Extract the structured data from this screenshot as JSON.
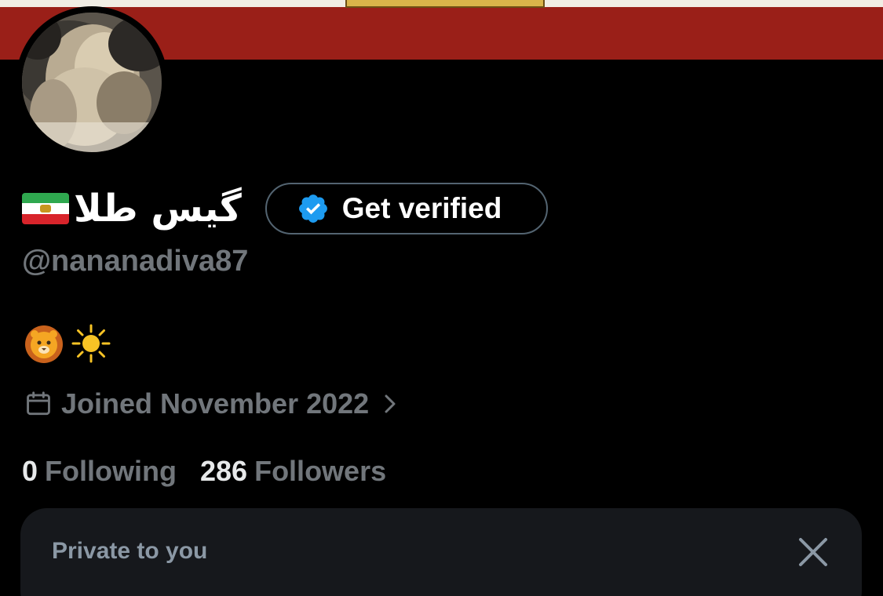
{
  "profile": {
    "display_name": "گیس طلا",
    "flag_icon": "iran-lion-and-sun-flag",
    "handle": "@nananadiva87",
    "bio_emojis": [
      "lion-face-emoji",
      "sun-emoji"
    ],
    "joined_text": "Joined November 2022"
  },
  "verify_button": {
    "label": "Get verified",
    "icon": "verified-badge-icon",
    "badge_color": "#1d9bf0"
  },
  "stats": {
    "following_count": "0",
    "following_label": "Following",
    "followers_count": "286",
    "followers_label": "Followers"
  },
  "private_card": {
    "title": "Private to you",
    "close_icon": "close-icon"
  },
  "colors": {
    "banner": "#9a1f18",
    "background": "#000000",
    "muted_text": "#71767b",
    "card_bg": "#16181c"
  }
}
